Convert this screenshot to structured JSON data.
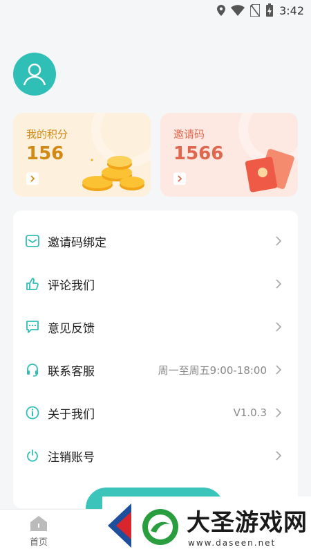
{
  "status_bar": {
    "time": "3:42"
  },
  "cards": {
    "points": {
      "title": "我的积分",
      "value": "156"
    },
    "invite": {
      "title": "邀请码",
      "value": "1566"
    }
  },
  "menu": {
    "items": [
      {
        "label": "邀请码绑定",
        "value": ""
      },
      {
        "label": "评论我们",
        "value": ""
      },
      {
        "label": "意见反馈",
        "value": ""
      },
      {
        "label": "联系客服",
        "value": "周一至周五9:00-18:00"
      },
      {
        "label": "关于我们",
        "value": "V1.0.3"
      },
      {
        "label": "注销账号",
        "value": ""
      }
    ]
  },
  "tabbar": {
    "home_label": "首页"
  },
  "watermark": {
    "text": "大圣游戏网",
    "url": "www.daseen.net"
  },
  "colors": {
    "accent": "#2fbfb7",
    "points": "#d38a14",
    "invite": "#e0674d"
  }
}
